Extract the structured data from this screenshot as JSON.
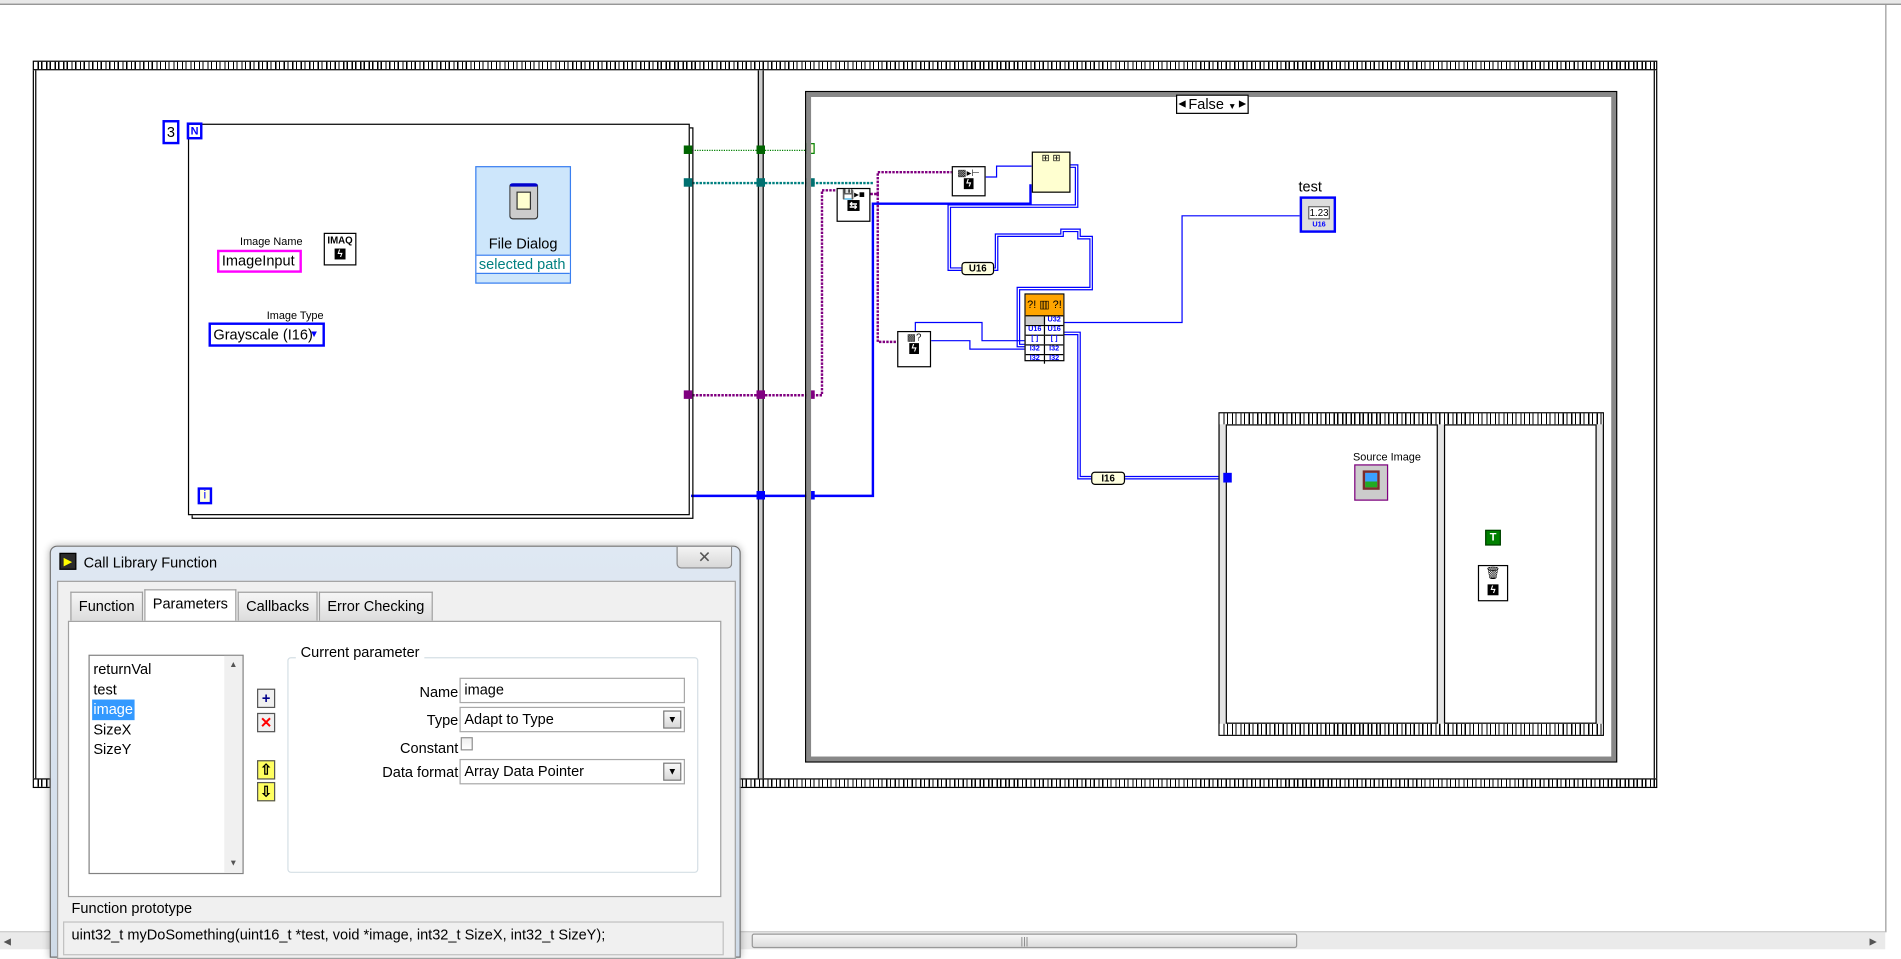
{
  "diagram": {
    "loop_count": "3",
    "loop_count_terminal": "N",
    "iteration_terminal": "i",
    "image_name_label": "Image Name",
    "image_name_value": "ImageInput",
    "imaq_create_label": "IMAQ",
    "image_type_label": "Image Type",
    "image_type_value": "Grayscale (I16)",
    "file_dialog_title": "File Dialog",
    "file_dialog_output": "selected path",
    "case_selector_value": "False",
    "u16_constant": "U16",
    "i16_constant": "I16",
    "test_indicator_label": "test",
    "test_indicator_display": "1.23",
    "test_indicator_type": "U16",
    "source_image_label": "Source Image",
    "true_constant": "T",
    "clf_terminals": [
      "U32",
      "U16",
      "[ ]",
      "I32",
      "I32"
    ],
    "colors": {
      "integer_wire": "#0000ff",
      "image_wire": "#800080",
      "path_wire": "#008080",
      "bool_wire": "#008000",
      "string_wire": "#ff00ff",
      "clf_node": "#ffa500"
    }
  },
  "dialog": {
    "title": "Call Library Function",
    "close_icon": "close-icon",
    "tabs": [
      {
        "label": "Function",
        "active": false
      },
      {
        "label": "Parameters",
        "active": true
      },
      {
        "label": "Callbacks",
        "active": false
      },
      {
        "label": "Error Checking",
        "active": false
      }
    ],
    "parameters": [
      "returnVal",
      "test",
      "image",
      "SizeX",
      "SizeY"
    ],
    "selected_parameter": "image",
    "group_title": "Current parameter",
    "name_label": "Name",
    "name_value": "image",
    "type_label": "Type",
    "type_value": "Adapt to Type",
    "constant_label": "Constant",
    "constant_checked": false,
    "data_format_label": "Data format",
    "data_format_value": "Array Data Pointer",
    "prototype_label": "Function prototype",
    "prototype_value": "uint32_t myDoSomething(uint16_t *test, void *image, int32_t SizeX, int32_t SizeY);"
  }
}
